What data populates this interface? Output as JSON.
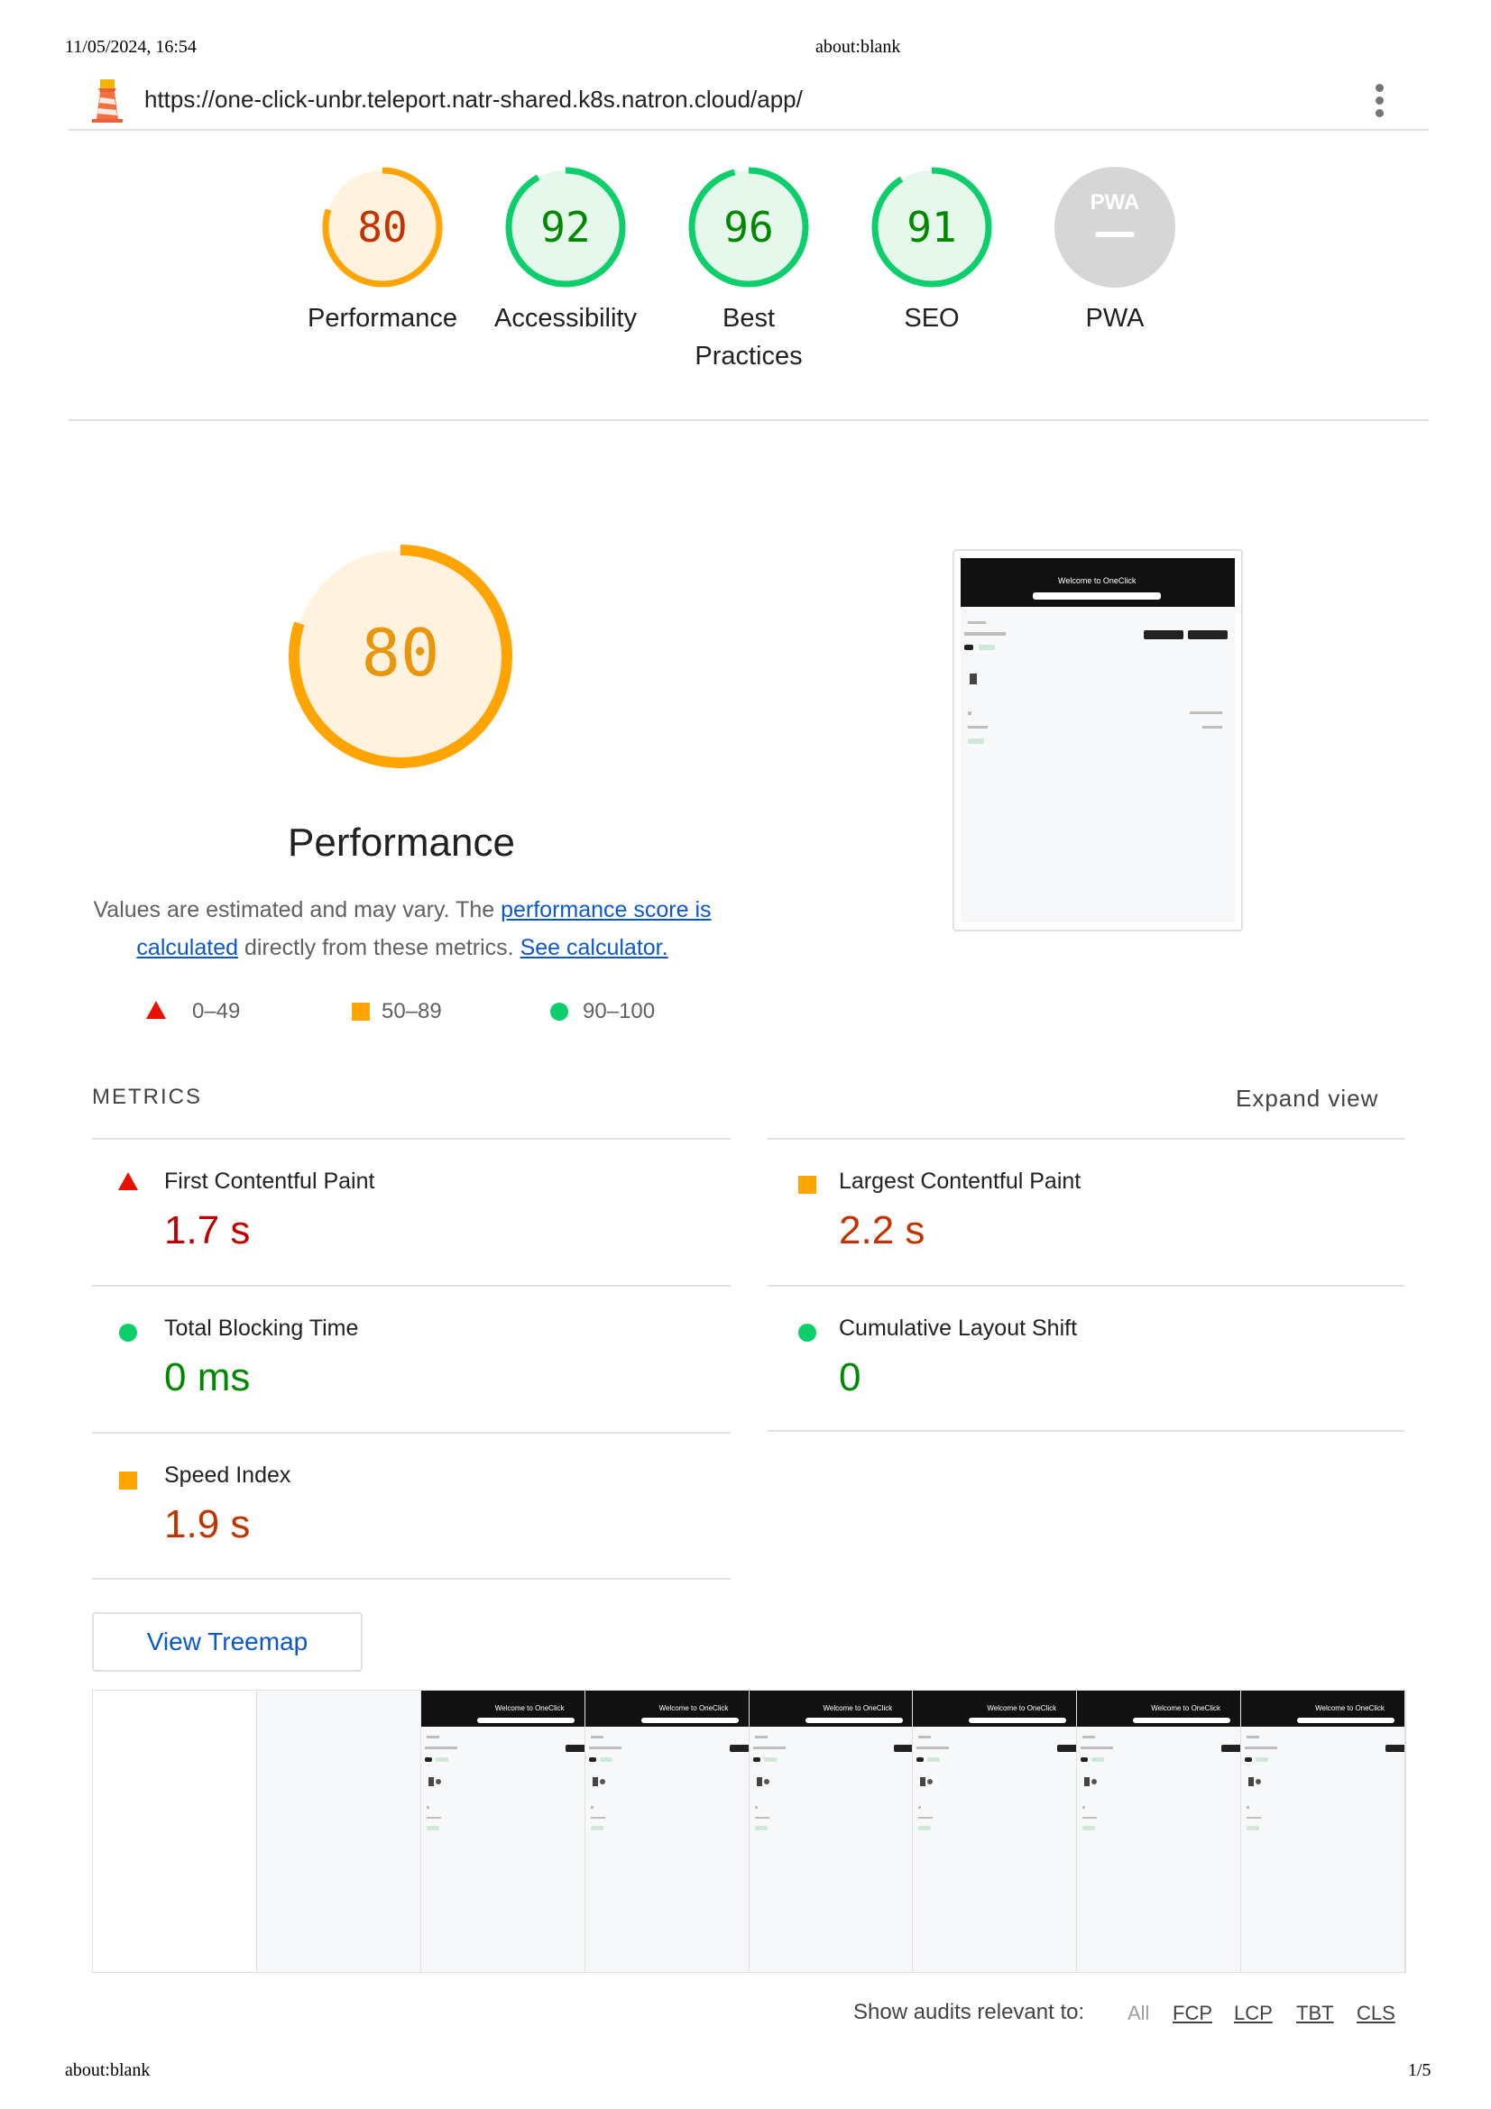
{
  "print_header": {
    "datetime": "11/05/2024, 16:54",
    "title": "about:blank"
  },
  "print_footer": {
    "left": "about:blank",
    "page": "1/5"
  },
  "topbar": {
    "url": "https://one-click-unbr.teleport.natr-shared.k8s.natron.cloud/app/",
    "menu_icon": "kebab-menu-icon",
    "logo_icon": "lighthouse-icon"
  },
  "gauges": [
    {
      "label": "Performance",
      "score": 80,
      "color": "#ffa400",
      "text_color": "#c33300",
      "bg": "#fff3e0"
    },
    {
      "label": "Accessibility",
      "score": 92,
      "color": "#0cce6b",
      "text_color": "#008800",
      "bg": "#e6f8ec"
    },
    {
      "label": "Best Practices",
      "score": 96,
      "color": "#0cce6b",
      "text_color": "#008800",
      "bg": "#e6f8ec"
    },
    {
      "label": "SEO",
      "score": 91,
      "color": "#0cce6b",
      "text_color": "#008800",
      "bg": "#e6f8ec"
    },
    {
      "label": "PWA",
      "badge": "PWA",
      "color": "#d6d6d6"
    }
  ],
  "performance": {
    "score": 80,
    "score_color": "#ffa400",
    "title": "Performance",
    "desc_pre": "Values are estimated and may vary. The ",
    "desc_link1": "performance score is calculated",
    "desc_mid": " directly from these metrics. ",
    "desc_link2": "See calculator.",
    "legend": [
      "0–49",
      "50–89",
      "90–100"
    ]
  },
  "metrics": {
    "heading": "METRICS",
    "expand_label": "Expand view",
    "items": [
      {
        "title": "First Contentful Paint",
        "value": "1.7 s",
        "status": "fail"
      },
      {
        "title": "Largest Contentful Paint",
        "value": "2.2 s",
        "status": "average"
      },
      {
        "title": "Total Blocking Time",
        "value": "0 ms",
        "status": "pass"
      },
      {
        "title": "Cumulative Layout Shift",
        "value": "0",
        "status": "pass"
      },
      {
        "title": "Speed Index",
        "value": "1.9 s",
        "status": "average"
      }
    ]
  },
  "treemap_button": "View Treemap",
  "screenshot": {
    "banner_text": "Welcome to OneClick"
  },
  "filmstrip": {
    "frame_count": 8,
    "blank_frames": 2,
    "banner_text": "Welcome to OneClick"
  },
  "audit_filter": {
    "label": "Show audits relevant to:",
    "chips": [
      "All",
      "FCP",
      "LCP",
      "TBT",
      "CLS"
    ]
  }
}
